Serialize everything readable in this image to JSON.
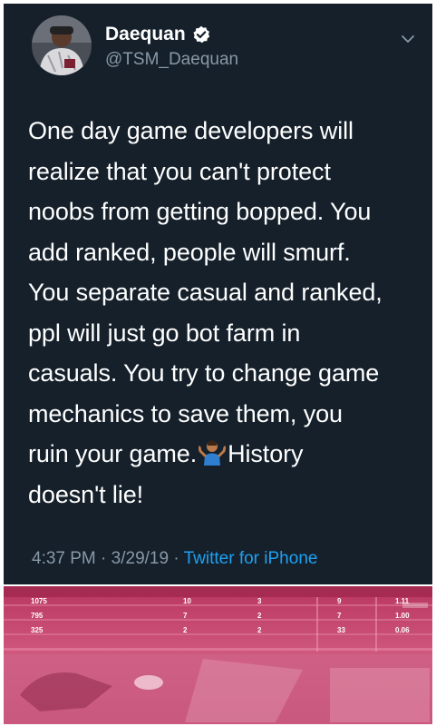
{
  "tweet": {
    "author": {
      "display_name": "Daequan",
      "handle": "@TSM_Daequan",
      "verified": true
    },
    "text_lines": [
      "One day game developers will",
      "realize that you can't protect",
      "noobs from getting bopped. You",
      "add ranked, people will smurf.",
      "You separate casual and ranked,",
      "ppl will just go bot farm in",
      "casuals. You try to change game",
      "mechanics to save them, you",
      "ruin your game.",
      "History",
      "doesn't lie!"
    ],
    "emoji": "person-shrugging-emoji",
    "time": "4:37 PM",
    "separator": " · ",
    "date": "3/29/19",
    "source": "Twitter for iPhone"
  },
  "photo": {
    "stats_rows": [
      [
        "1075",
        "10",
        "3",
        "9",
        "1.11"
      ],
      [
        "795",
        "7",
        "2",
        "7",
        "1.00"
      ],
      [
        "325",
        "2",
        "2",
        "33",
        "0.06"
      ]
    ]
  },
  "colors": {
    "card_bg": "#15202b",
    "secondary_text": "#8899a6",
    "link": "#1da1f2",
    "photo_tint": "#c2406e"
  }
}
